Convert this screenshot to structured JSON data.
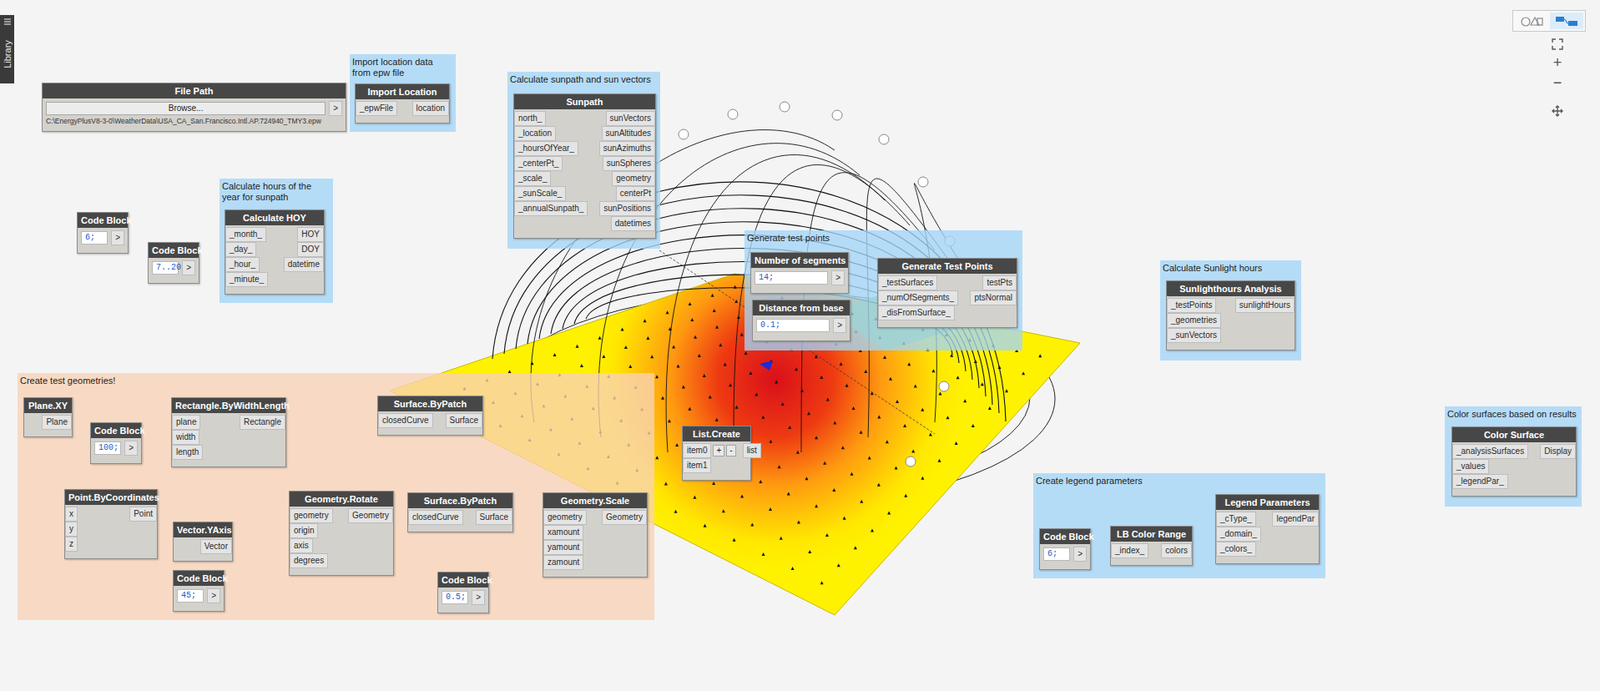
{
  "library_tab": {
    "label": "Library"
  },
  "view_modes": [
    {
      "selected": false
    },
    {
      "selected": true
    }
  ],
  "zoom_controls": [
    "+",
    "−"
  ],
  "groups": [
    {
      "title": "Import location data from epw file",
      "color": "#a3d5f7"
    },
    {
      "title": "Calculate sunpath and sun vectors",
      "color": "#a3d5f7"
    },
    {
      "title": "Calculate hours of the year for sunpath",
      "color": "#a3d5f7"
    },
    {
      "title": "Generate test points",
      "color": "#a3d5f7"
    },
    {
      "title": "Calculate Sunlight hours",
      "color": "#a3d5f7"
    },
    {
      "title": "Color surfaces based on results",
      "color": "#a3d5f7"
    },
    {
      "title": "Create legend parameters",
      "color": "#a3d5f7"
    },
    {
      "title": "Create test geometries!",
      "color": "#f8d3b6"
    }
  ],
  "nodes": [
    {
      "title": "File Path",
      "kind": "file",
      "button": "Browse...",
      "path": "C:\\EnergyPlusV8-3-0\\WeatherData\\USA_CA_San.Francisco.Intl.AP.724940_TMY3.epw",
      "inputs": [],
      "outputs": [
        ">"
      ]
    },
    {
      "title": "Import Location",
      "kind": "node",
      "inputs": [
        "_epwFile"
      ],
      "outputs": [
        "location"
      ]
    },
    {
      "title": "Sunpath",
      "kind": "node",
      "inputs": [
        "north_",
        "_location",
        "_hoursOfYear_",
        "_centerPt_",
        "_scale_",
        "_sunScale_",
        "_annualSunpath_"
      ],
      "outputs": [
        "sunVectors",
        "sunAltitudes",
        "sunAzimuths",
        "sunSpheres",
        "geometry",
        "centerPt",
        "sunPositions",
        "datetimes"
      ]
    },
    {
      "title": "Code Block",
      "kind": "code",
      "value": "6;",
      "inputs": [],
      "outputs": [
        ">"
      ]
    },
    {
      "title": "Code Block",
      "kind": "code",
      "value": "7..20;",
      "inputs": [],
      "outputs": [
        ">"
      ]
    },
    {
      "title": "Calculate HOY",
      "kind": "node",
      "inputs": [
        "_month_",
        "_day_",
        "_hour_",
        "_minute_"
      ],
      "outputs": [
        "HOY",
        "DOY",
        "datetime"
      ]
    },
    {
      "title": "Number of segments",
      "kind": "code",
      "value": "14;",
      "inputs": [],
      "outputs": [
        ">"
      ]
    },
    {
      "title": "Distance from base",
      "kind": "code",
      "value": "0.1;",
      "inputs": [],
      "outputs": [
        ">"
      ]
    },
    {
      "title": "Generate Test Points",
      "kind": "node",
      "inputs": [
        "_testSurfaces",
        "_numOfSegments_",
        "_disFromSurface_"
      ],
      "outputs": [
        "testPts",
        "ptsNormal"
      ]
    },
    {
      "title": "Sunlighthours Analysis",
      "kind": "node",
      "inputs": [
        "_testPoints",
        "_geometries",
        "_sunVectors"
      ],
      "outputs": [
        "sunlightHours"
      ]
    },
    {
      "title": "Color Surface",
      "kind": "node",
      "inputs": [
        "_analysisSurfaces",
        "_values",
        "_legendPar_"
      ],
      "outputs": [
        "Display"
      ]
    },
    {
      "title": "Code Block",
      "kind": "code",
      "value": "6;",
      "inputs": [],
      "outputs": [
        ">"
      ]
    },
    {
      "title": "LB Color Range",
      "kind": "node",
      "inputs": [
        "_index_"
      ],
      "outputs": [
        "colors"
      ]
    },
    {
      "title": "Legend Parameters",
      "kind": "node",
      "inputs": [
        "_cType_",
        "_domain_",
        "_colors_"
      ],
      "outputs": [
        "legendPar"
      ]
    },
    {
      "title": "Plane.XY",
      "kind": "node",
      "inputs": [],
      "outputs": [
        "Plane"
      ]
    },
    {
      "title": "Code Block",
      "kind": "code",
      "value": "100;",
      "inputs": [],
      "outputs": [
        ">"
      ]
    },
    {
      "title": "Rectangle.ByWidthLength",
      "kind": "node",
      "inputs": [
        "plane",
        "width",
        "length"
      ],
      "outputs": [
        "Rectangle"
      ]
    },
    {
      "title": "Surface.ByPatch",
      "kind": "node",
      "inputs": [
        "closedCurve"
      ],
      "outputs": [
        "Surface"
      ]
    },
    {
      "title": "Point.ByCoordinates",
      "kind": "node",
      "inputs": [
        "x",
        "y",
        "z"
      ],
      "outputs": [
        "Point"
      ]
    },
    {
      "title": "Vector.YAxis",
      "kind": "node",
      "inputs": [],
      "outputs": [
        "Vector"
      ]
    },
    {
      "title": "Code Block",
      "kind": "code",
      "value": "45;",
      "inputs": [],
      "outputs": [
        ">"
      ]
    },
    {
      "title": "Geometry.Rotate",
      "kind": "node",
      "inputs": [
        "geometry",
        "origin",
        "axis",
        "degrees"
      ],
      "outputs": [
        "Geometry"
      ]
    },
    {
      "title": "Surface.ByPatch",
      "kind": "node",
      "inputs": [
        "closedCurve"
      ],
      "outputs": [
        "Surface"
      ]
    },
    {
      "title": "Code Block",
      "kind": "code",
      "value": "0.5;",
      "inputs": [],
      "outputs": [
        ">"
      ]
    },
    {
      "title": "Geometry.Scale",
      "kind": "node",
      "inputs": [
        "geometry",
        "xamount",
        "yamount",
        "zamount"
      ],
      "outputs": [
        "Geometry"
      ]
    },
    {
      "title": "List.Create",
      "kind": "node",
      "inputs": [
        "item0",
        "item1"
      ],
      "outputs": [
        "list"
      ],
      "buttons": [
        "+",
        "-"
      ]
    }
  ],
  "wires": [
    {
      "from": [
        0,
        0
      ],
      "to": [
        1,
        0
      ]
    },
    {
      "from": [
        1,
        0
      ],
      "to": [
        2,
        1
      ]
    },
    {
      "from": [
        3,
        0
      ],
      "to": [
        5,
        0
      ]
    },
    {
      "from": [
        4,
        0
      ],
      "to": [
        5,
        2
      ]
    },
    {
      "from": [
        5,
        0
      ],
      "to": [
        2,
        2
      ]
    },
    {
      "from": [
        2,
        0
      ],
      "to": [
        9,
        2
      ]
    },
    {
      "from": [
        6,
        0
      ],
      "to": [
        8,
        1
      ]
    },
    {
      "from": [
        7,
        0
      ],
      "to": [
        8,
        2
      ]
    },
    {
      "from": [
        25,
        0
      ],
      "to": [
        8,
        0
      ]
    },
    {
      "from": [
        8,
        0
      ],
      "to": [
        9,
        0
      ]
    },
    {
      "from": [
        25,
        0
      ],
      "to": [
        9,
        1
      ]
    },
    {
      "from": [
        25,
        0
      ],
      "to": [
        10,
        0
      ]
    },
    {
      "from": [
        9,
        0
      ],
      "to": [
        10,
        1
      ]
    },
    {
      "from": [
        13,
        0
      ],
      "to": [
        10,
        2
      ]
    },
    {
      "from": [
        11,
        0
      ],
      "to": [
        12,
        0
      ]
    },
    {
      "from": [
        12,
        0
      ],
      "to": [
        13,
        2
      ]
    },
    {
      "from": [
        14,
        0
      ],
      "to": [
        16,
        0
      ]
    },
    {
      "from": [
        15,
        0
      ],
      "to": [
        16,
        1
      ]
    },
    {
      "from": [
        15,
        0
      ],
      "to": [
        16,
        2
      ]
    },
    {
      "from": [
        16,
        0
      ],
      "to": [
        17,
        0
      ]
    },
    {
      "from": [
        16,
        0
      ],
      "to": [
        21,
        0
      ]
    },
    {
      "from": [
        18,
        0
      ],
      "to": [
        21,
        1
      ]
    },
    {
      "from": [
        19,
        0
      ],
      "to": [
        21,
        2
      ]
    },
    {
      "from": [
        20,
        0
      ],
      "to": [
        21,
        3
      ]
    },
    {
      "from": [
        21,
        0
      ],
      "to": [
        22,
        0
      ]
    },
    {
      "from": [
        22,
        0
      ],
      "to": [
        24,
        0
      ]
    },
    {
      "from": [
        23,
        0
      ],
      "to": [
        24,
        1
      ]
    },
    {
      "from": [
        23,
        0
      ],
      "to": [
        24,
        2
      ]
    },
    {
      "from": [
        23,
        0
      ],
      "to": [
        24,
        3
      ]
    },
    {
      "from": [
        17,
        0
      ],
      "to": [
        25,
        0
      ]
    },
    {
      "from": [
        24,
        0
      ],
      "to": [
        25,
        1
      ]
    }
  ]
}
